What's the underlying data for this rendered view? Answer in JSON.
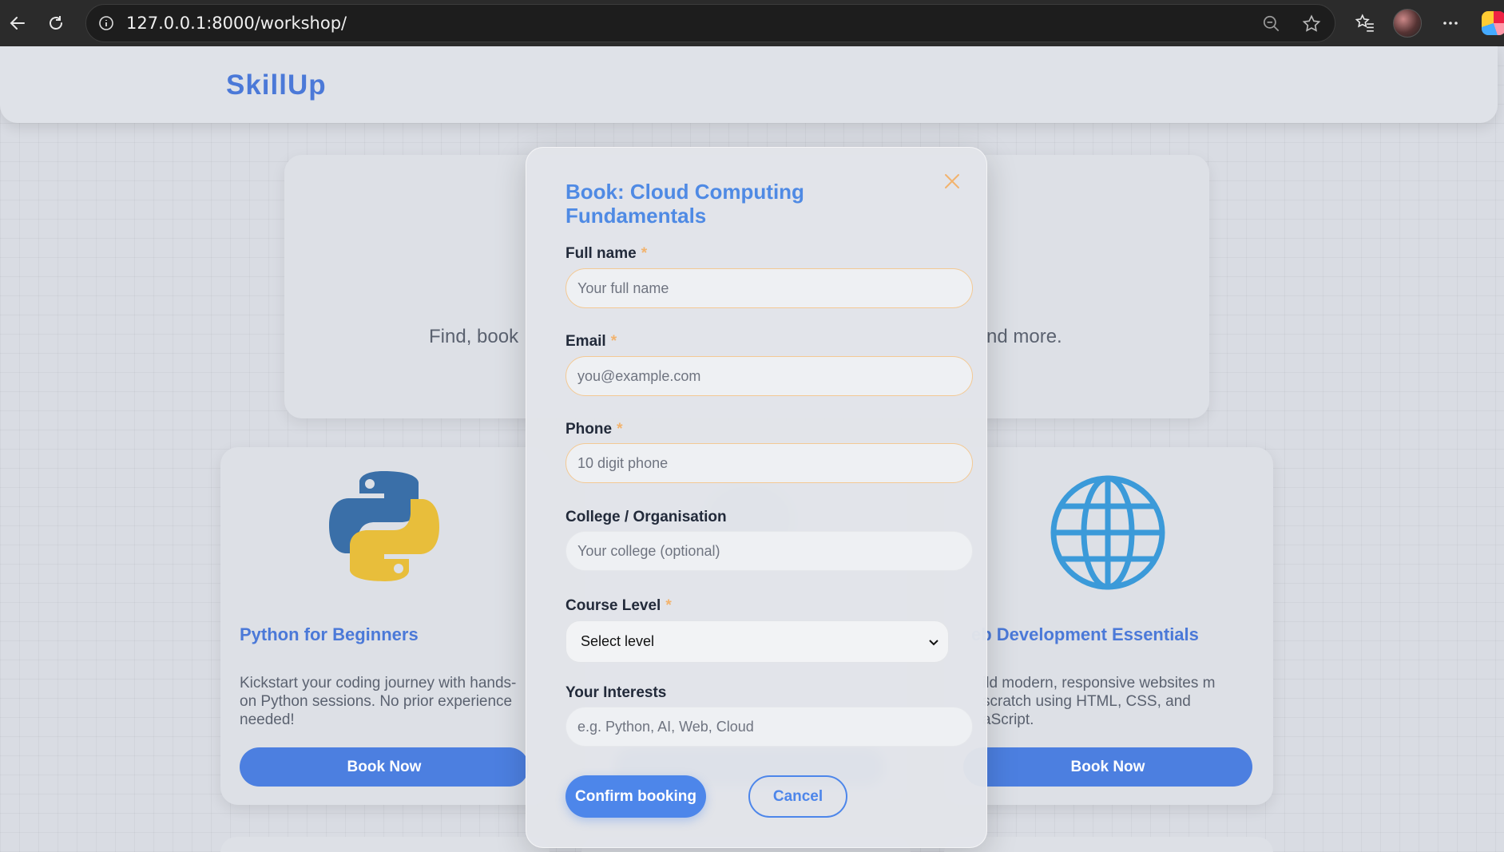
{
  "browser": {
    "url": "127.0.0.1:8000/workshop/"
  },
  "site": {
    "logo": "SkillUp",
    "hero_sub_left": "Find, book",
    "hero_sub_right": "nd more."
  },
  "cards": [
    {
      "title": "Python for Beginners",
      "desc": "Kickstart your coding journey with hands-on Python sessions. No prior experience needed!",
      "button": "Book Now"
    },
    {
      "title": "",
      "desc": "",
      "button": ""
    },
    {
      "title": "eb Development Essentials",
      "desc": "ild modern, responsive websites m scratch using HTML, CSS, and aScript.",
      "button": "Book Now"
    }
  ],
  "modal": {
    "title": "Book: Cloud Computing Fundamentals",
    "required_mark": "*",
    "fields": {
      "name_label": "Full name",
      "name_placeholder": "Your full name",
      "email_label": "Email",
      "email_placeholder": "you@example.com",
      "phone_label": "Phone",
      "phone_placeholder": "10 digit phone",
      "college_label": "College / Organisation",
      "college_placeholder": "Your college (optional)",
      "level_label": "Course Level",
      "level_value": "Select level",
      "interests_label": "Your Interests",
      "interests_placeholder": "e.g. Python, AI, Web, Cloud"
    },
    "confirm_label": "Confirm booking",
    "cancel_label": "Cancel"
  },
  "colors": {
    "accent": "#4f8ae4",
    "required": "#f2b36e"
  }
}
